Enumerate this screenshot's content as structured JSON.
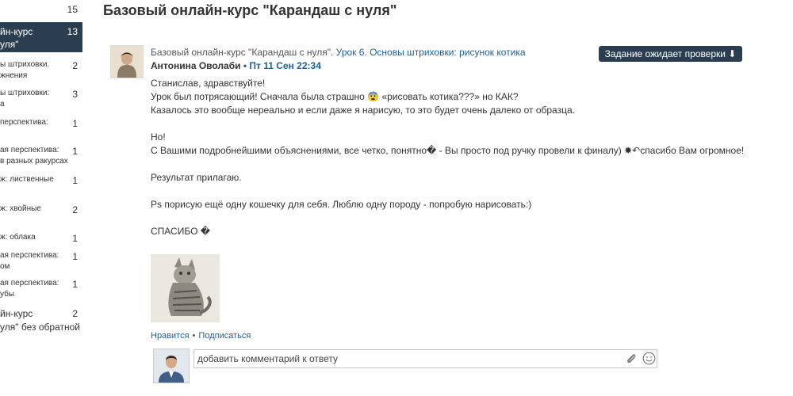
{
  "sidebar": {
    "items": [
      {
        "label": "",
        "count": "15"
      },
      {
        "label": "йн-курс",
        "label2": "уля\"",
        "count": "13"
      },
      {
        "label": "ы штриховки.",
        "label2": "жнения",
        "count": "2"
      },
      {
        "label": "ы штриховки:",
        "label2": "а",
        "count": "3"
      },
      {
        "label": "перспектива:",
        "label2": "",
        "count": "1"
      },
      {
        "label": "ая перспектива:",
        "label2": "в разных ракурсах",
        "count": "1"
      },
      {
        "label": "ж: лиственные",
        "label2": "",
        "count": "1"
      },
      {
        "label": "ж: хвойные",
        "label2": "",
        "count": "2"
      },
      {
        "label": "ж: облака",
        "label2": "",
        "count": "1"
      },
      {
        "label": "ая перспектива:",
        "label2": "ом",
        "count": "1"
      },
      {
        "label": "ая перспектива:",
        "label2": "убы",
        "count": "1"
      },
      {
        "label": "йн-курс",
        "label2": "уля\" без обратной",
        "count": "2"
      }
    ]
  },
  "page": {
    "title": "Базовый онлайн-курс \"Карандаш с нуля\""
  },
  "post": {
    "course": "Базовый онлайн-курс \"Карандаш с нуля\".",
    "lesson": "Урок 6. Основы штриховки: рисунок котика",
    "author": "Антонина Оволаби",
    "separator": "•",
    "date": "Пт 11 Сен 22:34",
    "status": "Задание ожидает проверки ⬇",
    "lines": [
      "Станислав, здравствуйте!",
      "Урок был потрясающий! Сначала была страшно 😨 «рисовать котика???» но КАК?",
      "Казалось это вообще нереально и если даже я нарисую, то это будет очень далеко от образца.",
      "",
      "Но!",
      "С Вашими подробнейшими объяснениями, все четко, понятно� - Вы просто под ручку провели к финалу) ✸↶спасибо Вам огромное!",
      "",
      "Результат прилагаю.",
      "",
      "Ps порисую ещё одну кошечку для себя. Люблю одну породу - попробую нарисовать:)",
      "",
      "СПАСИБО �"
    ],
    "like": "Нравится",
    "action_separator": "•",
    "subscribe": "Подписаться"
  },
  "comment": {
    "placeholder": "добавить комментарий к ответу"
  },
  "icons": {
    "attach": "paperclip-icon",
    "emoji": "smiley-icon"
  },
  "colors": {
    "accent_dark": "#2b3e50",
    "link": "#1f5f98"
  }
}
